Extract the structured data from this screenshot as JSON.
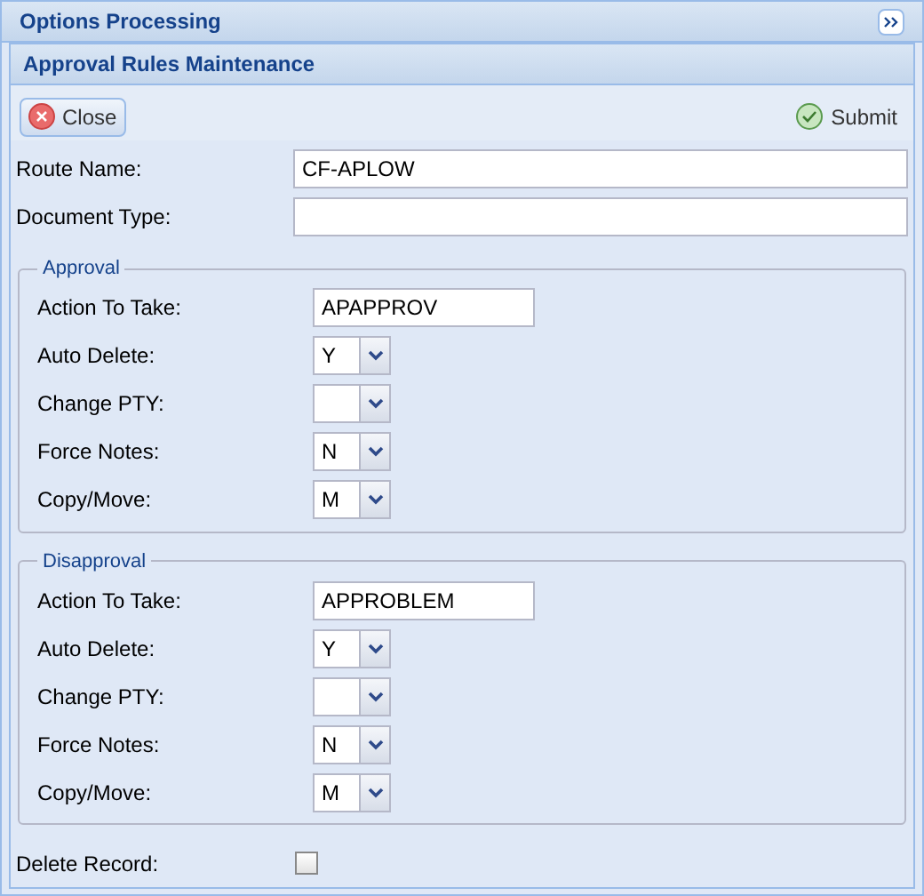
{
  "window": {
    "title": "Options Processing"
  },
  "panel": {
    "title": "Approval Rules Maintenance"
  },
  "toolbar": {
    "close": "Close",
    "submit": "Submit"
  },
  "fields": [
    {
      "label": "Route Name:",
      "value": "CF-APLOW"
    },
    {
      "label": "Document Type:"
    }
  ],
  "sections": [
    {
      "legend": "Approval",
      "fields": [
        {
          "kind": "text",
          "label": "Action To Take:",
          "value": "APAPPROV"
        },
        {
          "kind": "select",
          "label": "Auto Delete:",
          "value": "Y"
        },
        {
          "kind": "select",
          "label": "Change PTY:"
        },
        {
          "kind": "select",
          "label": "Force Notes:",
          "value": "N"
        },
        {
          "kind": "select",
          "label": "Copy/Move:",
          "value": "M"
        }
      ]
    },
    {
      "legend": "Disapproval",
      "fields": [
        {
          "kind": "text",
          "label": "Action To Take:",
          "value": "APPROBLEM"
        },
        {
          "kind": "select",
          "label": "Auto Delete:",
          "value": "Y"
        },
        {
          "kind": "select",
          "label": "Change PTY:"
        },
        {
          "kind": "select",
          "label": "Force Notes:",
          "value": "N"
        },
        {
          "kind": "select",
          "label": "Copy/Move:",
          "value": "M"
        }
      ]
    }
  ],
  "delete_record": {
    "label": "Delete Record:",
    "checked": false
  }
}
